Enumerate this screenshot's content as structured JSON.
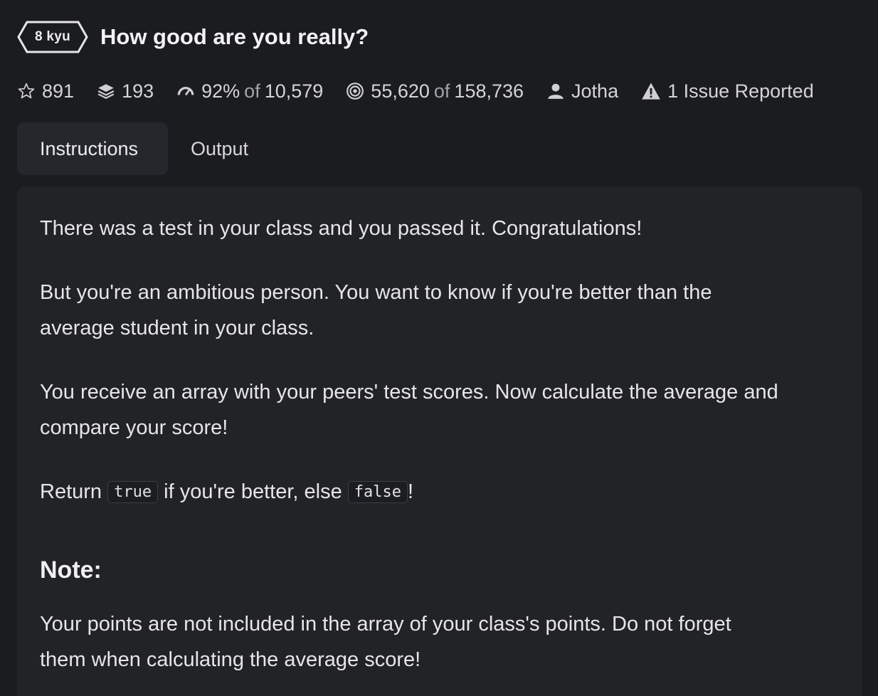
{
  "kata": {
    "rank": "8 kyu",
    "title": "How good are you really?"
  },
  "stats": {
    "stars": "891",
    "collections": "193",
    "satisfaction_pct": "92%",
    "of_word": "of",
    "satisfaction_votes": "10,579",
    "completed": "55,620",
    "attempted": "158,736",
    "author": "Jotha",
    "issues": "1 Issue Reported"
  },
  "tabs": [
    {
      "label": "Instructions",
      "active": true
    },
    {
      "label": "Output",
      "active": false
    }
  ],
  "instructions": {
    "p1": "There was a test in your class and you passed it. Congratulations!",
    "p2_line1": "But you're an ambitious person. You want to know if you're better than the",
    "p2_line2": "average student in your class.",
    "p3_line1": "You receive an array with your peers' test scores. Now calculate the average and",
    "p3_line2": "compare your score!",
    "p4_start": "Return",
    "p4_code_true": "true",
    "p4_middle": "if you're better, else",
    "p4_code_false": "false",
    "p4_end": "!",
    "note_heading": "Note:",
    "note_line1": "Your points are not included in the array of your class's points. Do not forget",
    "note_line2": "them when calculating the average score!"
  },
  "colors": {
    "background": "#1b1c20",
    "panel": "#222327",
    "text": "#e6e6e9",
    "muted": "#a2a3a8"
  }
}
